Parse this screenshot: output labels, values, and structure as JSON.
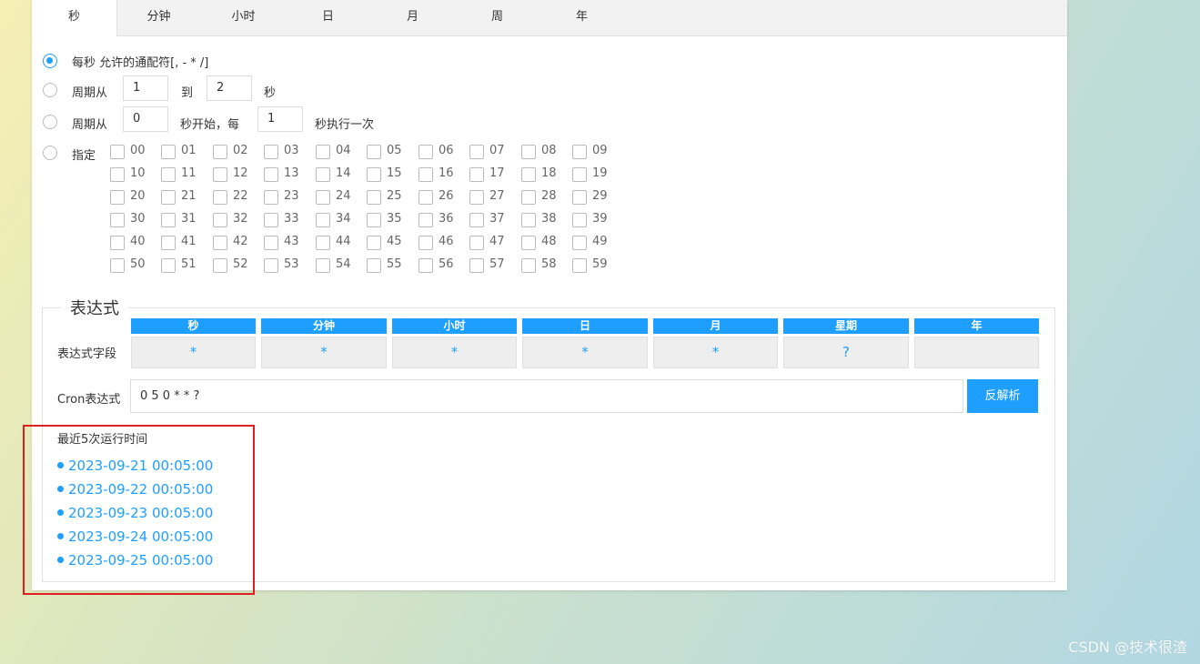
{
  "tabs": [
    "秒",
    "分钟",
    "小时",
    "日",
    "月",
    "周",
    "年"
  ],
  "options": {
    "every": "每秒 允许的通配符[, - * /]",
    "period_from": "周期从",
    "period_to": "到",
    "period_unit": "秒",
    "period_from_value": "1",
    "period_to_value": "2",
    "loop_from": "周期从",
    "loop_start": "秒开始，每",
    "loop_end": "秒执行一次",
    "loop_start_value": "0",
    "loop_step_value": "1",
    "specify": "指定"
  },
  "seconds": [
    "00",
    "01",
    "02",
    "03",
    "04",
    "05",
    "06",
    "07",
    "08",
    "09",
    "10",
    "11",
    "12",
    "13",
    "14",
    "15",
    "16",
    "17",
    "18",
    "19",
    "20",
    "21",
    "22",
    "23",
    "24",
    "25",
    "26",
    "27",
    "28",
    "29",
    "30",
    "31",
    "32",
    "33",
    "34",
    "35",
    "36",
    "37",
    "38",
    "39",
    "40",
    "41",
    "42",
    "43",
    "44",
    "45",
    "46",
    "47",
    "48",
    "49",
    "50",
    "51",
    "52",
    "53",
    "54",
    "55",
    "56",
    "57",
    "58",
    "59"
  ],
  "expression": {
    "legend": "表达式",
    "fields_label": "表达式字段",
    "columns": [
      {
        "name": "秒",
        "value": "*"
      },
      {
        "name": "分钟",
        "value": "*"
      },
      {
        "name": "小时",
        "value": "*"
      },
      {
        "name": "日",
        "value": "*"
      },
      {
        "name": "月",
        "value": "*"
      },
      {
        "name": "星期",
        "value": "?"
      },
      {
        "name": "年",
        "value": ""
      }
    ],
    "cron_label": "Cron表达式",
    "cron_value": "0 5 0 * * ?",
    "parse_button": "反解析",
    "runs_title": "最近5次运行时间",
    "runs": [
      "2023-09-21 00:05:00",
      "2023-09-22 00:05:00",
      "2023-09-23 00:05:00",
      "2023-09-24 00:05:00",
      "2023-09-25 00:05:00"
    ]
  },
  "watermark": "CSDN @技术很渣",
  "colors": {
    "accent": "#1e9fff",
    "highlight": "#e02020"
  }
}
